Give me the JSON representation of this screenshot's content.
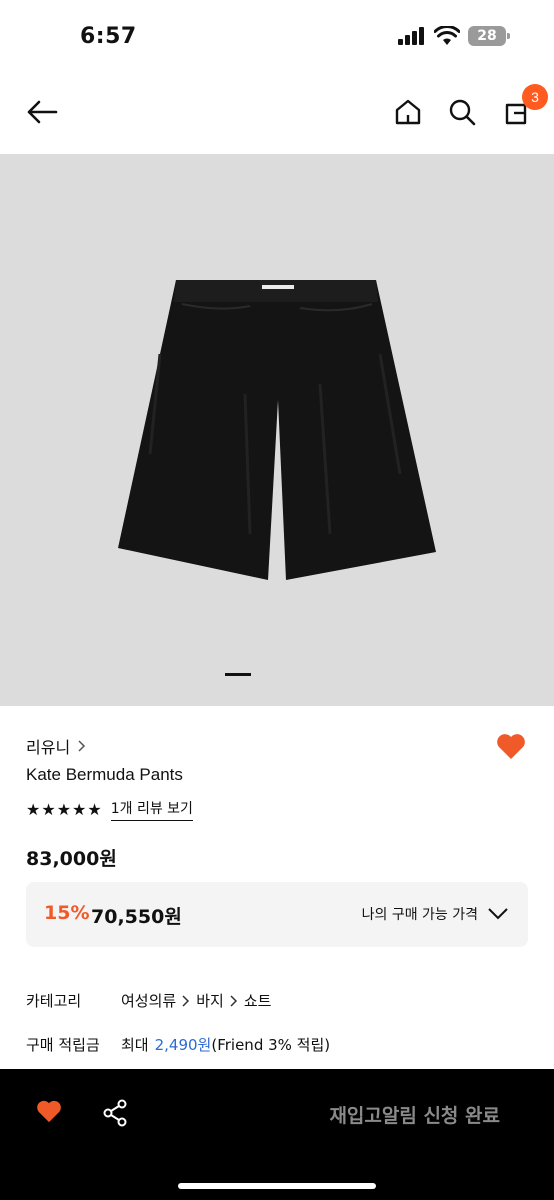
{
  "status": {
    "time": "6:57",
    "battery": "28"
  },
  "nav": {
    "cart_count": "3"
  },
  "product": {
    "brand": "리유니",
    "name": "Kate Bermuda Pants",
    "rating_stars": "★★★★★",
    "review_link": "1개 리뷰 보기",
    "original_price": "83,000원",
    "discount_percent": "15%",
    "discount_price": "70,550원",
    "price_toggle": "나의 구매 가능 가격"
  },
  "info": {
    "category_label": "카테고리",
    "category_path": [
      "여성의류",
      "바지",
      "쇼트"
    ],
    "points_label": "구매 적립금",
    "points_prefix": "최대",
    "points_amount": "2,490원",
    "points_suffix": "(Friend 3% 적립)"
  },
  "bottom_bar": {
    "restock_label": "재입고알림 신청 완료"
  },
  "colors": {
    "accent": "#ff5a1f",
    "heart": "#f05a28",
    "link": "#2b6bd6",
    "image_bg": "#dcdcdc"
  },
  "icons": [
    "back-arrow-icon",
    "home-icon",
    "search-icon",
    "cart-icon",
    "heart-icon",
    "share-icon",
    "chevron-right-icon",
    "chevron-down-icon"
  ]
}
